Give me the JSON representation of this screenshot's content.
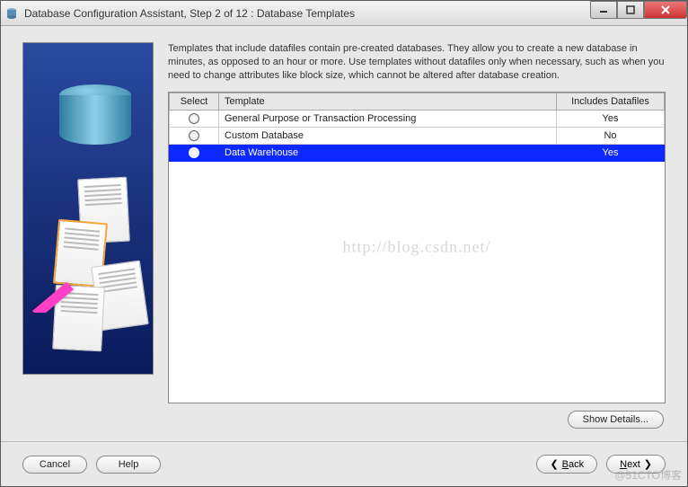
{
  "window": {
    "title": "Database Configuration Assistant, Step 2 of 12 : Database Templates"
  },
  "description": "Templates that include datafiles contain pre-created databases. They allow you to create a new database in minutes, as opposed to an hour or more. Use templates without datafiles only when necessary, such as when you need to change attributes like block size, which cannot be altered after database creation.",
  "table": {
    "headers": {
      "select": "Select",
      "template": "Template",
      "includes": "Includes Datafiles"
    },
    "rows": [
      {
        "template": "General Purpose or Transaction Processing",
        "includes": "Yes",
        "selected": false
      },
      {
        "template": "Custom Database",
        "includes": "No",
        "selected": false
      },
      {
        "template": "Data Warehouse",
        "includes": "Yes",
        "selected": true
      }
    ]
  },
  "watermark": "http://blog.csdn.net/",
  "buttons": {
    "show_details": "Show Details...",
    "cancel": "Cancel",
    "help": "Help",
    "back": "Back",
    "next": "Next"
  },
  "branding": "@51CTO博客"
}
